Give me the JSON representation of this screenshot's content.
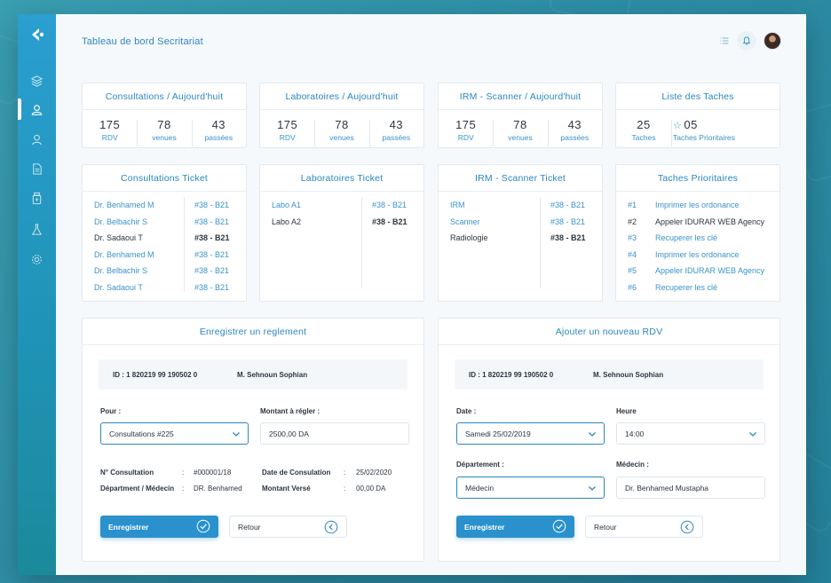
{
  "page_title": "Tableau de bord Secritariat",
  "colors": {
    "accent": "#2b86c0",
    "sidebar": "#2a9fd0",
    "dark_text": "#2c3540"
  },
  "header": {
    "icons": [
      "list-icon",
      "bell-icon",
      "avatar"
    ]
  },
  "sidebar": {
    "items": [
      "layers-icon",
      "users-icon",
      "user-icon",
      "document-icon",
      "bottle-icon",
      "flask-icon",
      "gear-icon"
    ],
    "active_index": 1
  },
  "summary_cards": [
    {
      "title": "Consultations / Aujourd'huit",
      "stats": [
        {
          "value": "175",
          "label": "RDV"
        },
        {
          "value": "78",
          "label": "venues"
        },
        {
          "value": "43",
          "label": "passées"
        }
      ]
    },
    {
      "title": "Laboratoires / Aujourd'huit",
      "stats": [
        {
          "value": "175",
          "label": "RDV"
        },
        {
          "value": "78",
          "label": "venues"
        },
        {
          "value": "43",
          "label": "passées"
        }
      ]
    },
    {
      "title": "IRM - Scanner / Aujourd'huit",
      "stats": [
        {
          "value": "175",
          "label": "RDV"
        },
        {
          "value": "78",
          "label": "venues"
        },
        {
          "value": "43",
          "label": "passées"
        }
      ]
    },
    {
      "title": "Liste des Taches",
      "stats": [
        {
          "value": "25",
          "label": "Taches"
        },
        {
          "value": "05",
          "label": "Taches Prioritaires"
        }
      ]
    }
  ],
  "tickets": {
    "consultations": {
      "title": "Consultations Ticket",
      "rows": [
        {
          "name": "Dr. Benhamed M",
          "code": "#38 - B21"
        },
        {
          "name": "Dr. Belbachir S",
          "code": "#38 - B21"
        },
        {
          "name": "Dr. Sadaoui T",
          "code": "#38 - B21"
        },
        {
          "name": "Dr. Benhamed M",
          "code": "#38 - B21"
        },
        {
          "name": "Dr. Belbachir S",
          "code": "#38 - B21"
        },
        {
          "name": "Dr. Sadaoui T",
          "code": "#38 - B21"
        }
      ]
    },
    "labs": {
      "title": "Laboratoires Ticket",
      "rows": [
        {
          "name": "Labo A1",
          "code": "#38 - B21"
        },
        {
          "name": "Labo A2",
          "code": "#38 - B21"
        }
      ]
    },
    "irm": {
      "title": "IRM - Scanner Ticket",
      "rows": [
        {
          "name": "IRM",
          "code": "#38 - B21"
        },
        {
          "name": "Scanner",
          "code": "#38 - B21"
        },
        {
          "name": "Radiologie",
          "code": "#38 - B21"
        }
      ]
    }
  },
  "priority_tasks": {
    "title": "Taches Prioritaires",
    "rows": [
      {
        "idx": "#1",
        "text": "Imprimer les ordonance"
      },
      {
        "idx": "#2",
        "text": "Appeler IDURAR WEB Agency"
      },
      {
        "idx": "#3",
        "text": "Recuperer les clé"
      },
      {
        "idx": "#4",
        "text": "Imprimer les ordonance"
      },
      {
        "idx": "#5",
        "text": "Appeler IDURAR WEB Agency"
      },
      {
        "idx": "#6",
        "text": "Recuperer les clé"
      }
    ]
  },
  "reglement": {
    "title": "Enregistrer un reglement",
    "id_text": "ID : 1 820219 99 190502 0",
    "patient": "M. Sehnoun Sophian",
    "pour_label": "Pour :",
    "pour_value": "Consultations #225",
    "montant_label": "Montant à régler :",
    "montant_value": "2500,00 DA",
    "consultation_no_label": "N° Consultation",
    "consultation_no_value": "#000001/18",
    "date_consultation_label": "Date de Consulation",
    "date_consultation_value": "25/02/2020",
    "dept_label": "Départment / Médecin",
    "dept_value": "DR. Benhamed",
    "montant_verse_label": "Montant Versé",
    "montant_verse_value": "00,00 DA",
    "colon": ":",
    "save_label": "Enregistrer",
    "back_label": "Retour"
  },
  "rdv": {
    "title": "Ajouter un nouveau RDV",
    "id_text": "ID : 1 820219 99 190502 0",
    "patient": "M. Sehnoun Sophian",
    "date_label": "Date  :",
    "date_value": "Samedi 25/02/2019",
    "heure_label": "Heure",
    "heure_value": "14:00",
    "dept_label": "Département :",
    "dept_value": "Médecin",
    "medecin_label": "Médecin :",
    "medecin_value": "Dr. Benhamed Mustapha",
    "save_label": "Enregistrer",
    "back_label": "Retour"
  }
}
